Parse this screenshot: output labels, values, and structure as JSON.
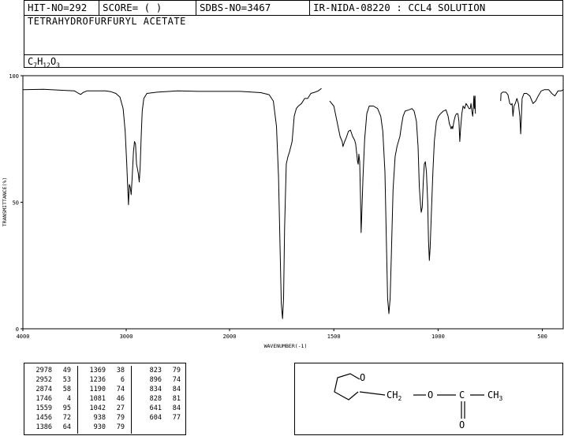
{
  "header": {
    "hit_no": "HIT-NO=292",
    "score": "SCORE=  (   )",
    "sdbs_no": "SDBS-NO=3467",
    "ir_no": "IR-NIDA-08220 : CCL4 SOLUTION",
    "compound_name": "TETRAHYDROFURFURYL ACETATE",
    "formula_parts": [
      "C",
      "7",
      "H",
      "12",
      "O",
      "3"
    ]
  },
  "chart_data": {
    "type": "line",
    "xlabel": "WAVENUMBER(-1)",
    "ylabel": "TRANSMITTANCE(%)",
    "xlim": [
      4000,
      400
    ],
    "ylim": [
      0,
      100
    ],
    "xticks": [
      4000,
      3000,
      2000,
      1500,
      1000,
      500
    ],
    "yticks": [
      0,
      50,
      100
    ],
    "series": [
      {
        "points": [
          [
            4000,
            94.5
          ],
          [
            3800,
            94.6
          ],
          [
            3600,
            94.2
          ],
          [
            3500,
            94.0
          ],
          [
            3460,
            93.0
          ],
          [
            3440,
            92.6
          ],
          [
            3420,
            93.3
          ],
          [
            3380,
            94.0
          ],
          [
            3200,
            94.0
          ],
          [
            3150,
            93.7
          ],
          [
            3100,
            93.0
          ],
          [
            3060,
            91.5
          ],
          [
            3030,
            87.0
          ],
          [
            3010,
            78.0
          ],
          [
            2995,
            65.0
          ],
          [
            2985,
            55.0
          ],
          [
            2978,
            49.0
          ],
          [
            2970,
            57.0
          ],
          [
            2962,
            56.0
          ],
          [
            2952,
            53.0
          ],
          [
            2942,
            60.0
          ],
          [
            2930,
            70.0
          ],
          [
            2920,
            74.0
          ],
          [
            2910,
            73.0
          ],
          [
            2900,
            65.0
          ],
          [
            2890,
            63.0
          ],
          [
            2882,
            61.0
          ],
          [
            2874,
            58.0
          ],
          [
            2865,
            64.0
          ],
          [
            2855,
            76.0
          ],
          [
            2845,
            86.0
          ],
          [
            2830,
            91.0
          ],
          [
            2800,
            93.0
          ],
          [
            2700,
            93.5
          ],
          [
            2500,
            94.0
          ],
          [
            2300,
            93.8
          ],
          [
            2100,
            93.8
          ],
          [
            1950,
            93.8
          ],
          [
            1850,
            93.3
          ],
          [
            1810,
            92.5
          ],
          [
            1790,
            90.0
          ],
          [
            1775,
            80.0
          ],
          [
            1765,
            60.0
          ],
          [
            1757,
            30.0
          ],
          [
            1752,
            10.0
          ],
          [
            1746,
            4.0
          ],
          [
            1741,
            12.0
          ],
          [
            1736,
            40.0
          ],
          [
            1728,
            65.0
          ],
          [
            1720,
            68.0
          ],
          [
            1712,
            70.0
          ],
          [
            1700,
            74.0
          ],
          [
            1690,
            84.0
          ],
          [
            1680,
            87.0
          ],
          [
            1670,
            88.0
          ],
          [
            1655,
            89.0
          ],
          [
            1640,
            91.0
          ],
          [
            1625,
            91.0
          ],
          [
            1610,
            93.0
          ],
          [
            1590,
            93.5
          ],
          [
            1575,
            94.0
          ],
          [
            1559,
            95.0
          ]
        ]
      },
      {
        "points": [
          [
            1520,
            90.0
          ],
          [
            1500,
            88.0
          ],
          [
            1485,
            82.0
          ],
          [
            1470,
            76.0
          ],
          [
            1460,
            74.0
          ],
          [
            1456,
            72.0
          ],
          [
            1448,
            74.0
          ],
          [
            1440,
            75.5
          ],
          [
            1430,
            78.0
          ],
          [
            1420,
            78.5
          ],
          [
            1410,
            76.0
          ],
          [
            1400,
            74.5
          ],
          [
            1395,
            73.0
          ],
          [
            1390,
            69.0
          ],
          [
            1386,
            66.0
          ],
          [
            1383,
            65.0
          ],
          [
            1380,
            69.0
          ],
          [
            1376,
            66.0
          ],
          [
            1372,
            52.0
          ],
          [
            1369,
            38.0
          ],
          [
            1366,
            45.0
          ],
          [
            1360,
            60.0
          ],
          [
            1352,
            75.0
          ],
          [
            1342,
            85.0
          ],
          [
            1330,
            88.0
          ],
          [
            1310,
            88.0
          ],
          [
            1290,
            87.0
          ],
          [
            1275,
            84.0
          ],
          [
            1265,
            78.0
          ],
          [
            1255,
            62.0
          ],
          [
            1248,
            35.0
          ],
          [
            1242,
            12.0
          ],
          [
            1236,
            6.0
          ],
          [
            1230,
            12.0
          ],
          [
            1224,
            30.0
          ],
          [
            1216,
            55.0
          ],
          [
            1206,
            68.0
          ],
          [
            1197,
            72.0
          ],
          [
            1190,
            74.0
          ],
          [
            1183,
            76.0
          ],
          [
            1176,
            80.0
          ],
          [
            1168,
            84.0
          ],
          [
            1158,
            86.0
          ],
          [
            1140,
            86.5
          ],
          [
            1125,
            87.0
          ],
          [
            1115,
            86.0
          ],
          [
            1104,
            82.0
          ],
          [
            1096,
            72.0
          ],
          [
            1090,
            56.0
          ],
          [
            1085,
            50.0
          ],
          [
            1081,
            46.0
          ],
          [
            1076,
            48.0
          ],
          [
            1071,
            58.0
          ],
          [
            1066,
            65.0
          ],
          [
            1061,
            66.0
          ],
          [
            1056,
            62.0
          ],
          [
            1050,
            50.0
          ],
          [
            1046,
            35.0
          ],
          [
            1042,
            27.0
          ],
          [
            1038,
            32.0
          ],
          [
            1032,
            46.0
          ],
          [
            1025,
            62.0
          ],
          [
            1018,
            74.0
          ],
          [
            1008,
            82.0
          ],
          [
            998,
            84.0
          ],
          [
            988,
            85.0
          ],
          [
            975,
            86.0
          ],
          [
            962,
            86.5
          ],
          [
            952,
            84.0
          ],
          [
            946,
            81.0
          ],
          [
            941,
            80.0
          ],
          [
            938,
            79.0
          ],
          [
            933,
            80.0
          ],
          [
            930,
            79.0
          ],
          [
            924,
            82.0
          ],
          [
            918,
            84.0
          ],
          [
            912,
            85.0
          ],
          [
            905,
            85.0
          ],
          [
            900,
            82.0
          ],
          [
            896,
            74.0
          ],
          [
            892,
            79.0
          ],
          [
            886,
            85.0
          ],
          [
            880,
            88.0
          ],
          [
            873,
            87.0
          ],
          [
            866,
            89.0
          ],
          [
            858,
            88.0
          ],
          [
            852,
            87.0
          ],
          [
            846,
            87.0
          ],
          [
            842,
            89.0
          ],
          [
            838,
            86.0
          ],
          [
            834,
            84.0
          ],
          [
            831,
            88.0
          ],
          [
            828,
            92.0
          ],
          [
            826,
            87.0
          ],
          [
            824,
            90.0
          ],
          [
            823,
            92.0
          ],
          [
            821,
            85.0
          ]
        ]
      },
      {
        "points": [
          [
            700,
            90.0
          ],
          [
            698,
            93.0
          ],
          [
            690,
            93.5
          ],
          [
            675,
            93.5
          ],
          [
            665,
            92.5
          ],
          [
            656,
            89.0
          ],
          [
            650,
            88.5
          ],
          [
            645,
            89.0
          ],
          [
            641,
            84.0
          ],
          [
            636,
            88.0
          ],
          [
            630,
            89.0
          ],
          [
            622,
            91.0
          ],
          [
            615,
            89.0
          ],
          [
            608,
            84.0
          ],
          [
            604,
            77.0
          ],
          [
            601,
            83.0
          ],
          [
            597,
            91.0
          ],
          [
            588,
            93.0
          ],
          [
            575,
            93.0
          ],
          [
            560,
            92.0
          ],
          [
            545,
            89.0
          ],
          [
            532,
            90.0
          ],
          [
            520,
            92.0
          ],
          [
            505,
            94.0
          ],
          [
            490,
            94.5
          ],
          [
            470,
            94.5
          ],
          [
            455,
            93.0
          ],
          [
            440,
            92.0
          ],
          [
            425,
            94.0
          ],
          [
            410,
            94.0
          ],
          [
            400,
            94.5
          ]
        ]
      }
    ]
  },
  "peak_table": [
    [
      [
        2978,
        49
      ],
      [
        2952,
        53
      ],
      [
        2874,
        58
      ],
      [
        1746,
        4
      ],
      [
        1559,
        95
      ],
      [
        1456,
        72
      ],
      [
        1386,
        64
      ]
    ],
    [
      [
        1369,
        38
      ],
      [
        1236,
        6
      ],
      [
        1190,
        74
      ],
      [
        1081,
        46
      ],
      [
        1042,
        27
      ],
      [
        938,
        79
      ],
      [
        930,
        79
      ]
    ],
    [
      [
        823,
        79
      ],
      [
        896,
        74
      ],
      [
        834,
        84
      ],
      [
        828,
        81
      ],
      [
        641,
        84
      ],
      [
        604,
        77
      ]
    ]
  ],
  "structure": {
    "ring_oxygen": "O",
    "ch2_label": "CH",
    "ch2_sub": "2",
    "ester_oxygen": "O",
    "carbon": "C",
    "methyl_label": "CH",
    "methyl_sub": "3",
    "carbonyl_oxygen": "O"
  }
}
